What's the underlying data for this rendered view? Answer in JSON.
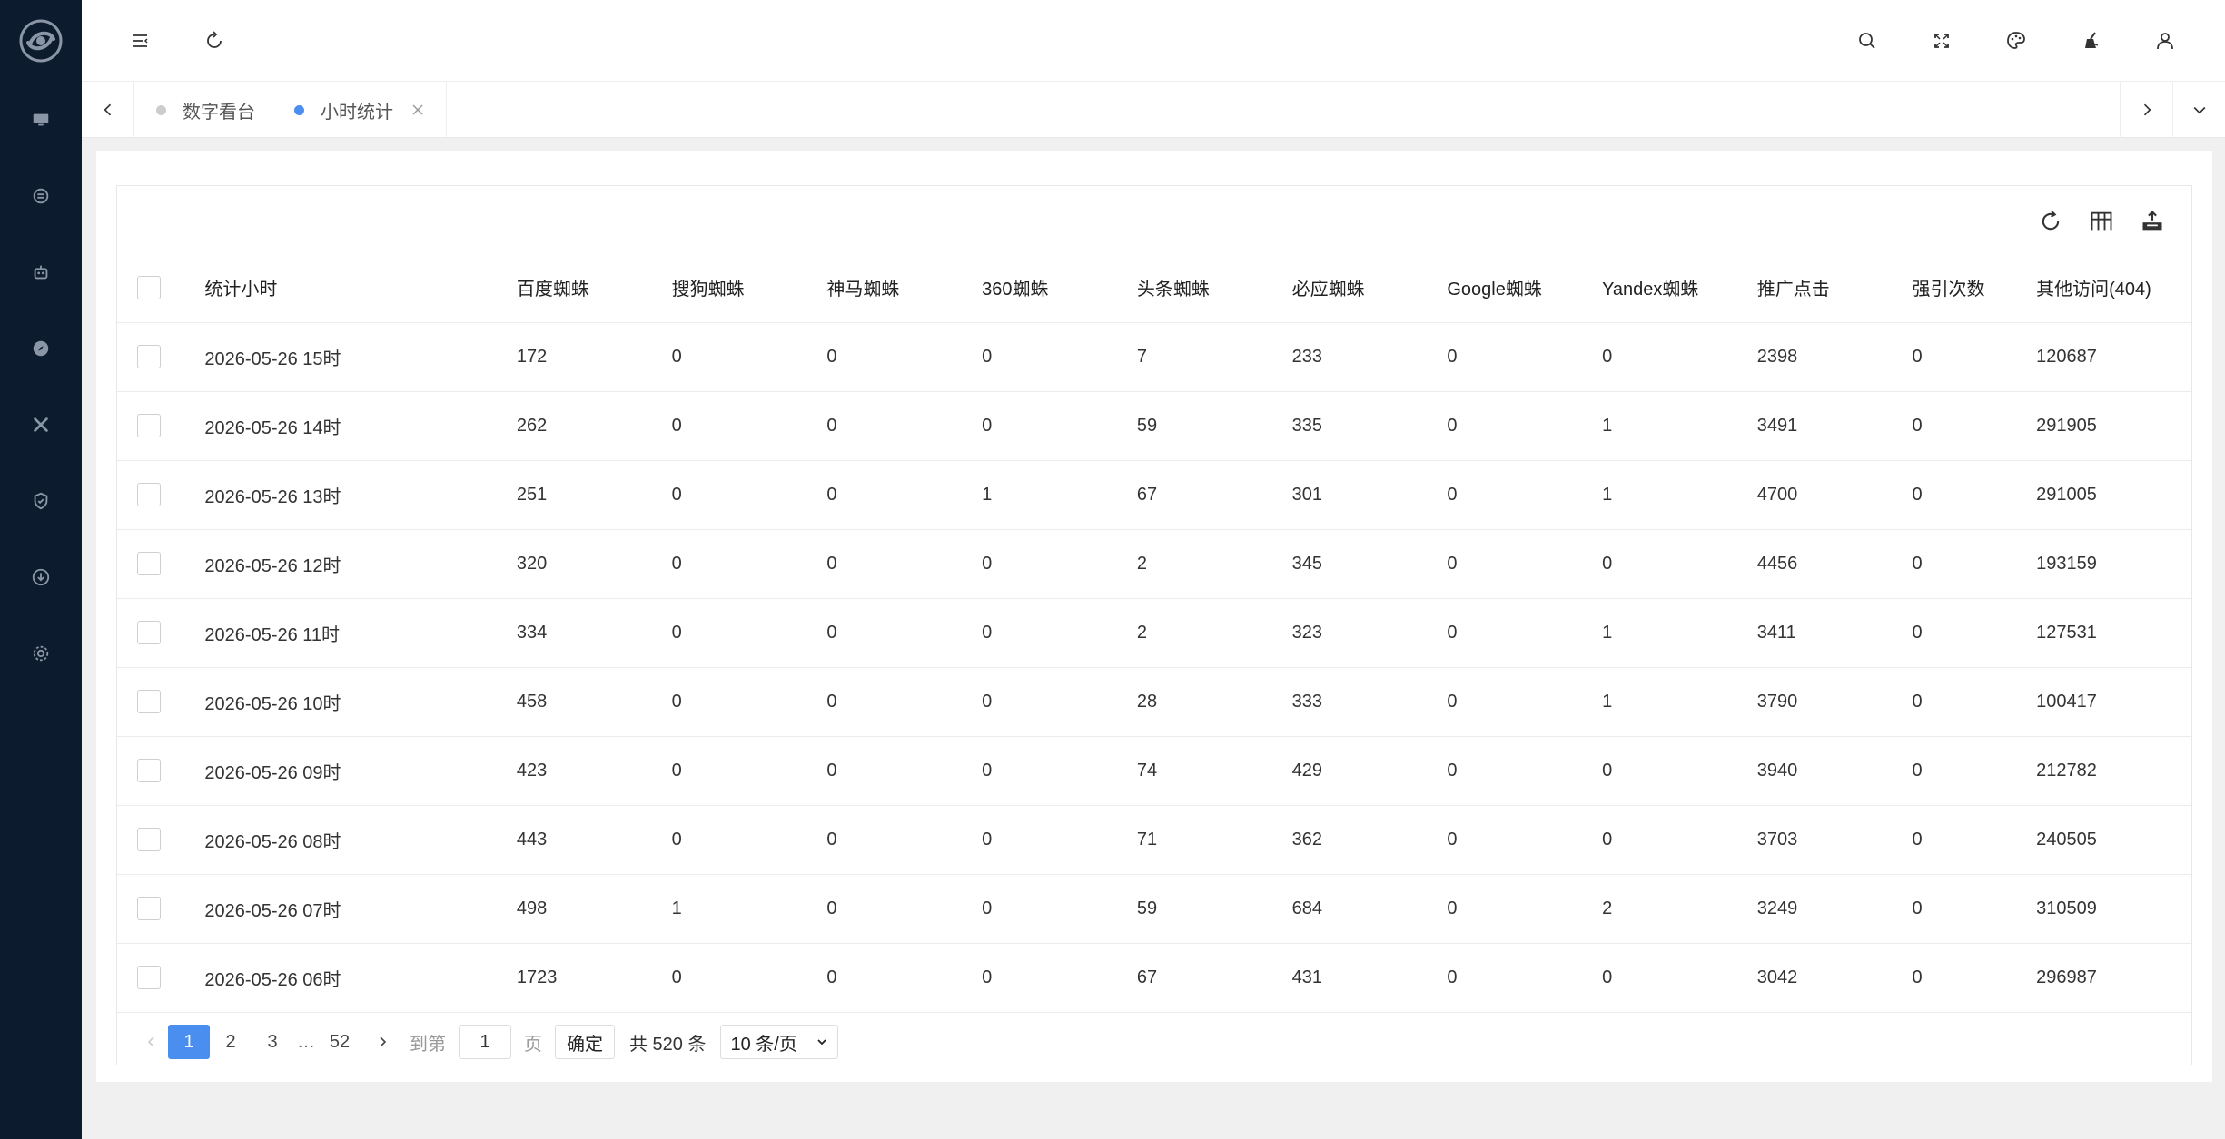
{
  "sidebar": {
    "items": [
      {
        "icon": "monitor-icon"
      },
      {
        "icon": "transfer-icon"
      },
      {
        "icon": "robot-icon"
      },
      {
        "icon": "compass-icon"
      },
      {
        "icon": "tools-icon"
      },
      {
        "icon": "shield-icon"
      },
      {
        "icon": "download-icon"
      },
      {
        "icon": "gear-icon"
      }
    ]
  },
  "tabs": [
    {
      "label": "数字看台",
      "active": false
    },
    {
      "label": "小时统计",
      "active": true
    }
  ],
  "table": {
    "headers": [
      "统计小时",
      "百度蜘蛛",
      "搜狗蜘蛛",
      "神马蜘蛛",
      "360蜘蛛",
      "头条蜘蛛",
      "必应蜘蛛",
      "Google蜘蛛",
      "Yandex蜘蛛",
      "推广点击",
      "强引次数",
      "其他访问(404)"
    ],
    "rows": [
      [
        "2026-05-26 15时",
        "172",
        "0",
        "0",
        "0",
        "7",
        "233",
        "0",
        "0",
        "2398",
        "0",
        "120687"
      ],
      [
        "2026-05-26 14时",
        "262",
        "0",
        "0",
        "0",
        "59",
        "335",
        "0",
        "1",
        "3491",
        "0",
        "291905"
      ],
      [
        "2026-05-26 13时",
        "251",
        "0",
        "0",
        "1",
        "67",
        "301",
        "0",
        "1",
        "4700",
        "0",
        "291005"
      ],
      [
        "2026-05-26 12时",
        "320",
        "0",
        "0",
        "0",
        "2",
        "345",
        "0",
        "0",
        "4456",
        "0",
        "193159"
      ],
      [
        "2026-05-26 11时",
        "334",
        "0",
        "0",
        "0",
        "2",
        "323",
        "0",
        "1",
        "3411",
        "0",
        "127531"
      ],
      [
        "2026-05-26 10时",
        "458",
        "0",
        "0",
        "0",
        "28",
        "333",
        "0",
        "1",
        "3790",
        "0",
        "100417"
      ],
      [
        "2026-05-26 09时",
        "423",
        "0",
        "0",
        "0",
        "74",
        "429",
        "0",
        "0",
        "3940",
        "0",
        "212782"
      ],
      [
        "2026-05-26 08时",
        "443",
        "0",
        "0",
        "0",
        "71",
        "362",
        "0",
        "0",
        "3703",
        "0",
        "240505"
      ],
      [
        "2026-05-26 07时",
        "498",
        "1",
        "0",
        "0",
        "59",
        "684",
        "0",
        "2",
        "3249",
        "0",
        "310509"
      ],
      [
        "2026-05-26 06时",
        "1723",
        "0",
        "0",
        "0",
        "67",
        "431",
        "0",
        "0",
        "3042",
        "0",
        "296987"
      ]
    ]
  },
  "pagination": {
    "pages": [
      "1",
      "2",
      "3"
    ],
    "ellipsis": "…",
    "last_page": "52",
    "goto_label": "到第",
    "goto_value": "1",
    "page_unit": "页",
    "confirm": "确定",
    "total": "共 520 条",
    "page_size": "10 条/页"
  },
  "colors": {
    "sidebar_bg": "#0d1b2e",
    "accent": "#4a8ef0",
    "inactive_dot": "#cccccc"
  }
}
